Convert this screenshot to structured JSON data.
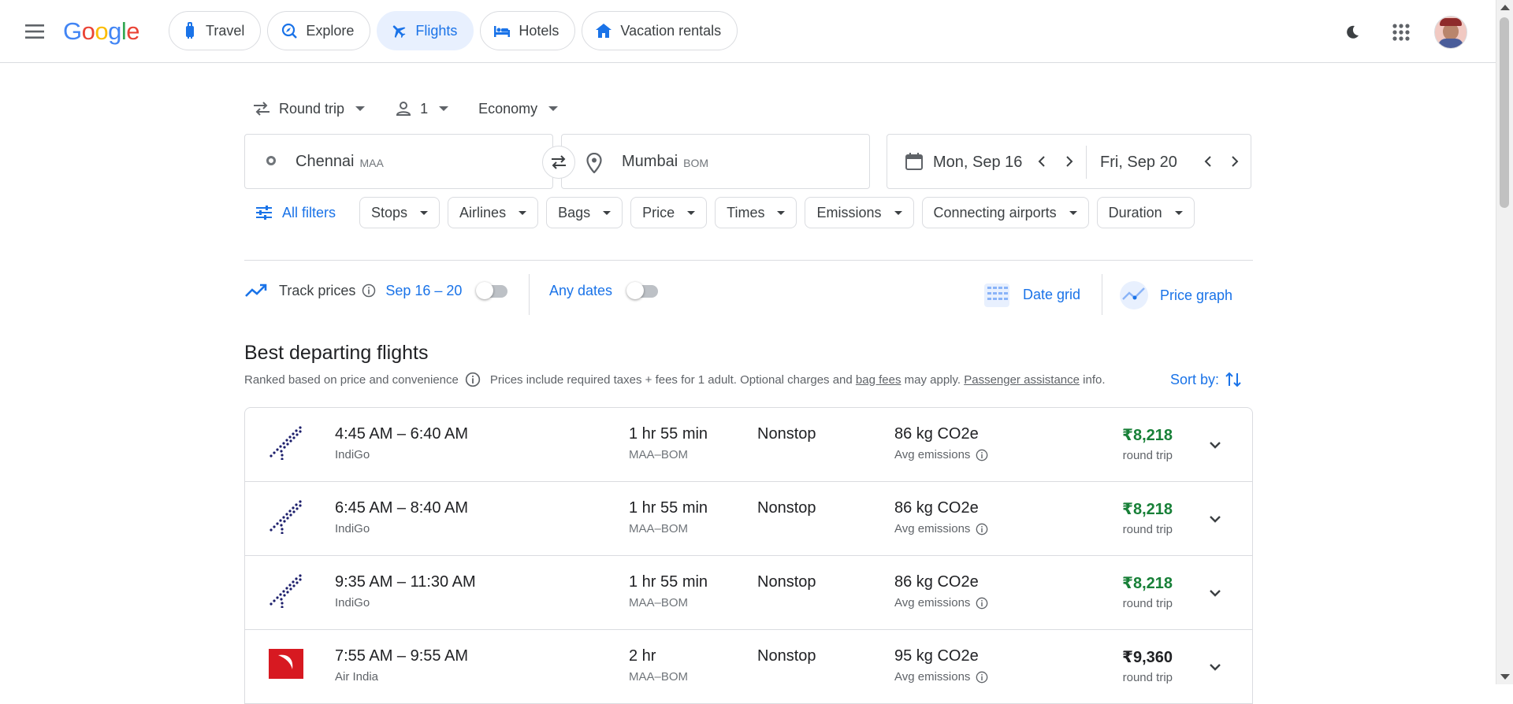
{
  "header": {
    "logo": [
      "G",
      "o",
      "o",
      "g",
      "l",
      "e"
    ],
    "nav": [
      {
        "label": "Travel",
        "icon": "luggage-icon"
      },
      {
        "label": "Explore",
        "icon": "explore-icon"
      },
      {
        "label": "Flights",
        "icon": "flight-icon",
        "active": true
      },
      {
        "label": "Hotels",
        "icon": "bed-icon"
      },
      {
        "label": "Vacation rentals",
        "icon": "home-icon"
      }
    ]
  },
  "search": {
    "trip_type": "Round trip",
    "passengers": "1",
    "cabin": "Economy",
    "origin": {
      "city": "Chennai",
      "code": "MAA"
    },
    "destination": {
      "city": "Mumbai",
      "code": "BOM"
    },
    "depart_date": "Mon, Sep 16",
    "return_date": "Fri, Sep 20"
  },
  "filters": {
    "all_label": "All filters",
    "chips": [
      "Stops",
      "Airlines",
      "Bags",
      "Price",
      "Times",
      "Emissions",
      "Connecting airports",
      "Duration"
    ]
  },
  "track": {
    "label": "Track prices",
    "range": "Sep 16 – 20",
    "any_dates": "Any dates",
    "date_grid": "Date grid",
    "price_graph": "Price graph"
  },
  "results": {
    "title": "Best departing flights",
    "ranked": "Ranked based on price and convenience",
    "note_prefix": "Prices include required taxes + fees for 1 adult. Optional charges and",
    "bag_fees": "bag fees",
    "note_mid": "may apply.",
    "passenger_assistance": "Passenger assistance",
    "note_suffix": "info.",
    "sort_label": "Sort by:",
    "flights": [
      {
        "times": "4:45 AM – 6:40 AM",
        "airline": "IndiGo",
        "duration": "1 hr 55 min",
        "route": "MAA–BOM",
        "stops": "Nonstop",
        "emissions": "86 kg CO2e",
        "emissions_label": "Avg emissions",
        "price": "₹8,218",
        "price_type": "round trip",
        "price_color": "green",
        "logo": "indigo"
      },
      {
        "times": "6:45 AM – 8:40 AM",
        "airline": "IndiGo",
        "duration": "1 hr 55 min",
        "route": "MAA–BOM",
        "stops": "Nonstop",
        "emissions": "86 kg CO2e",
        "emissions_label": "Avg emissions",
        "price": "₹8,218",
        "price_type": "round trip",
        "price_color": "green",
        "logo": "indigo"
      },
      {
        "times": "9:35 AM – 11:30 AM",
        "airline": "IndiGo",
        "duration": "1 hr 55 min",
        "route": "MAA–BOM",
        "stops": "Nonstop",
        "emissions": "86 kg CO2e",
        "emissions_label": "Avg emissions",
        "price": "₹8,218",
        "price_type": "round trip",
        "price_color": "green",
        "logo": "indigo"
      },
      {
        "times": "7:55 AM – 9:55 AM",
        "airline": "Air India",
        "duration": "2 hr",
        "route": "MAA–BOM",
        "stops": "Nonstop",
        "emissions": "95 kg CO2e",
        "emissions_label": "Avg emissions",
        "price": "₹9,360",
        "price_type": "round trip",
        "price_color": "black",
        "logo": "airindia"
      }
    ]
  },
  "colors": {
    "accent": "#1a73e8",
    "price_good": "#188038",
    "border": "#dadce0"
  }
}
